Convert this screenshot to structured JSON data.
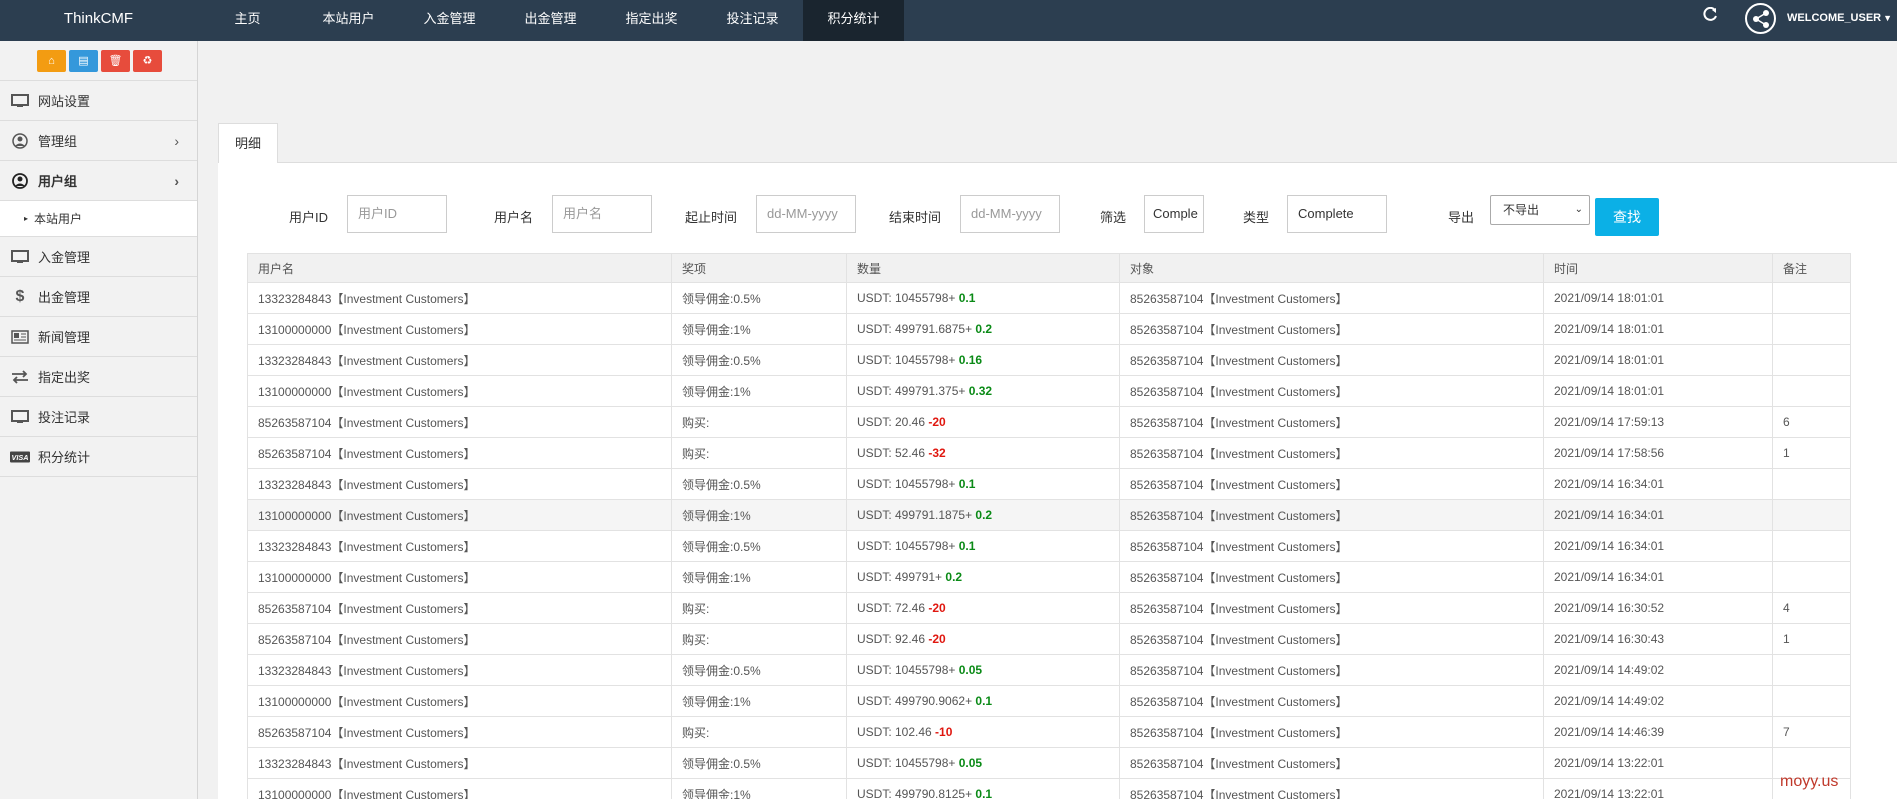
{
  "brand": "ThinkCMF",
  "top_nav": [
    {
      "label": "主页",
      "active": false
    },
    {
      "label": "本站用户",
      "active": false
    },
    {
      "label": "入金管理",
      "active": false
    },
    {
      "label": "出金管理",
      "active": false
    },
    {
      "label": "指定出奖",
      "active": false
    },
    {
      "label": "投注记录",
      "active": false
    },
    {
      "label": "积分统计",
      "active": true
    }
  ],
  "user": {
    "name": "WELCOME_USER"
  },
  "sidebar": {
    "items": [
      {
        "label": "网站设置",
        "icon": "monitor-icon"
      },
      {
        "label": "管理组",
        "icon": "user-circle-icon",
        "arrow": true
      },
      {
        "label": "用户组",
        "icon": "user-circle-icon",
        "arrow": true,
        "active": true
      },
      {
        "label": "本站用户",
        "sub": true
      },
      {
        "label": "入金管理",
        "icon": "monitor-icon"
      },
      {
        "label": "出金管理",
        "icon": "dollar-icon"
      },
      {
        "label": "新闻管理",
        "icon": "newspaper-icon"
      },
      {
        "label": "指定出奖",
        "icon": "exchange-icon"
      },
      {
        "label": "投注记录",
        "icon": "monitor-icon"
      },
      {
        "label": "积分统计",
        "icon": "visa-icon"
      }
    ]
  },
  "tab": {
    "label": "明细"
  },
  "filters": {
    "user_id": {
      "label": "用户ID",
      "placeholder": "用户ID"
    },
    "username": {
      "label": "用户名",
      "placeholder": "用户名"
    },
    "start_time": {
      "label": "起止时间",
      "placeholder": "dd-MM-yyyy"
    },
    "end_time": {
      "label": "结束时间",
      "placeholder": "dd-MM-yyyy"
    },
    "filter": {
      "label": "筛选",
      "value": "Comple"
    },
    "type": {
      "label": "类型",
      "value": "Complete"
    },
    "export": {
      "label": "导出",
      "value": "不导出"
    },
    "search_button": "查找"
  },
  "table": {
    "headers": [
      "用户名",
      "奖项",
      "数量",
      "对象",
      "时间",
      "备注"
    ],
    "rows": [
      {
        "user": "13323284843【Investment Customers】",
        "award": "领导佣金:0.5%",
        "amount_base": "USDT: 10455798+ ",
        "amount_delta": "0.1",
        "delta_sign": "pos",
        "target": "85263587104【Investment Customers】",
        "time": "2021/09/14 18:01:01",
        "note": ""
      },
      {
        "user": "13100000000【Investment Customers】",
        "award": "领导佣金:1%",
        "amount_base": "USDT: 499791.6875+ ",
        "amount_delta": "0.2",
        "delta_sign": "pos",
        "target": "85263587104【Investment Customers】",
        "time": "2021/09/14 18:01:01",
        "note": ""
      },
      {
        "user": "13323284843【Investment Customers】",
        "award": "领导佣金:0.5%",
        "amount_base": "USDT: 10455798+ ",
        "amount_delta": "0.16",
        "delta_sign": "pos",
        "target": "85263587104【Investment Customers】",
        "time": "2021/09/14 18:01:01",
        "note": ""
      },
      {
        "user": "13100000000【Investment Customers】",
        "award": "领导佣金:1%",
        "amount_base": "USDT: 499791.375+ ",
        "amount_delta": "0.32",
        "delta_sign": "pos",
        "target": "85263587104【Investment Customers】",
        "time": "2021/09/14 18:01:01",
        "note": ""
      },
      {
        "user": "85263587104【Investment Customers】",
        "award": "购买:",
        "amount_base": "USDT: 20.46 ",
        "amount_delta": "-20",
        "delta_sign": "neg",
        "target": "85263587104【Investment Customers】",
        "time": "2021/09/14 17:59:13",
        "note": "6"
      },
      {
        "user": "85263587104【Investment Customers】",
        "award": "购买:",
        "amount_base": "USDT: 52.46 ",
        "amount_delta": "-32",
        "delta_sign": "neg",
        "target": "85263587104【Investment Customers】",
        "time": "2021/09/14 17:58:56",
        "note": "1"
      },
      {
        "user": "13323284843【Investment Customers】",
        "award": "领导佣金:0.5%",
        "amount_base": "USDT: 10455798+ ",
        "amount_delta": "0.1",
        "delta_sign": "pos",
        "target": "85263587104【Investment Customers】",
        "time": "2021/09/14 16:34:01",
        "note": ""
      },
      {
        "user": "13100000000【Investment Customers】",
        "award": "领导佣金:1%",
        "amount_base": "USDT: 499791.1875+ ",
        "amount_delta": "0.2",
        "delta_sign": "pos",
        "target": "85263587104【Investment Customers】",
        "time": "2021/09/14 16:34:01",
        "note": "",
        "highlight": true
      },
      {
        "user": "13323284843【Investment Customers】",
        "award": "领导佣金:0.5%",
        "amount_base": "USDT: 10455798+ ",
        "amount_delta": "0.1",
        "delta_sign": "pos",
        "target": "85263587104【Investment Customers】",
        "time": "2021/09/14 16:34:01",
        "note": ""
      },
      {
        "user": "13100000000【Investment Customers】",
        "award": "领导佣金:1%",
        "amount_base": "USDT: 499791+ ",
        "amount_delta": "0.2",
        "delta_sign": "pos",
        "target": "85263587104【Investment Customers】",
        "time": "2021/09/14 16:34:01",
        "note": ""
      },
      {
        "user": "85263587104【Investment Customers】",
        "award": "购买:",
        "amount_base": "USDT: 72.46 ",
        "amount_delta": "-20",
        "delta_sign": "neg",
        "target": "85263587104【Investment Customers】",
        "time": "2021/09/14 16:30:52",
        "note": "4"
      },
      {
        "user": "85263587104【Investment Customers】",
        "award": "购买:",
        "amount_base": "USDT: 92.46 ",
        "amount_delta": "-20",
        "delta_sign": "neg",
        "target": "85263587104【Investment Customers】",
        "time": "2021/09/14 16:30:43",
        "note": "1"
      },
      {
        "user": "13323284843【Investment Customers】",
        "award": "领导佣金:0.5%",
        "amount_base": "USDT: 10455798+ ",
        "amount_delta": "0.05",
        "delta_sign": "pos",
        "target": "85263587104【Investment Customers】",
        "time": "2021/09/14 14:49:02",
        "note": ""
      },
      {
        "user": "13100000000【Investment Customers】",
        "award": "领导佣金:1%",
        "amount_base": "USDT: 499790.9062+ ",
        "amount_delta": "0.1",
        "delta_sign": "pos",
        "target": "85263587104【Investment Customers】",
        "time": "2021/09/14 14:49:02",
        "note": ""
      },
      {
        "user": "85263587104【Investment Customers】",
        "award": "购买:",
        "amount_base": "USDT: 102.46 ",
        "amount_delta": "-10",
        "delta_sign": "neg",
        "target": "85263587104【Investment Customers】",
        "time": "2021/09/14 14:46:39",
        "note": "7"
      },
      {
        "user": "13323284843【Investment Customers】",
        "award": "领导佣金:0.5%",
        "amount_base": "USDT: 10455798+ ",
        "amount_delta": "0.05",
        "delta_sign": "pos",
        "target": "85263587104【Investment Customers】",
        "time": "2021/09/14 13:22:01",
        "note": ""
      },
      {
        "user": "13100000000【Investment Customers】",
        "award": "领导佣金:1%",
        "amount_base": "USDT: 499790.8125+ ",
        "amount_delta": "0.1",
        "delta_sign": "pos",
        "target": "85263587104【Investment Customers】",
        "time": "2021/09/14 13:22:01",
        "note": ""
      }
    ]
  },
  "watermark": "moyy.us",
  "colors": {
    "topbar": "#2c3e50",
    "accent": "#0bb0e6",
    "positive": "#0a8a16",
    "negative": "#e0170f"
  }
}
